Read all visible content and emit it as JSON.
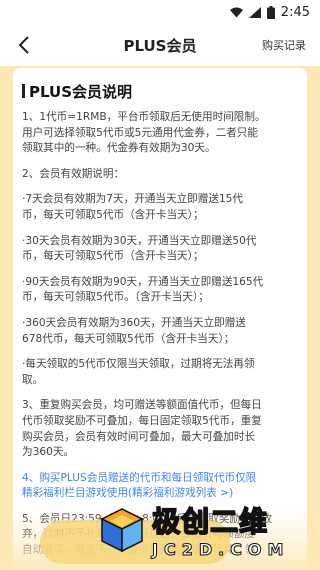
{
  "status_bar": {
    "time": "2:45"
  },
  "header": {
    "title": "PLUS会员",
    "records_link": "购买记录"
  },
  "card": {
    "title": "PLUS会员说明",
    "paragraphs": [
      {
        "lines": [
          "1、1代币=1RMB，平台币领取后无使用时间限制。",
          "用户可选择领取5代币或5元通用代金券，二者只能",
          "领取其中的一种。代金券有效期为30天。"
        ]
      },
      {
        "lines": [
          "2、会员有效期说明："
        ]
      },
      {
        "lines": [
          "·7天会员有效期为7天，开通当天立即赠送15代",
          "币，每天可领取5代币（含开卡当天）；"
        ]
      },
      {
        "lines": [
          "·30天会员有效期为30天，开通当天立即赠送50代",
          "币，每天可领取5代币（含开卡当天）；"
        ]
      },
      {
        "lines": [
          "·90天会员有效期为90天，开通当天立即赠送165代",
          "币，每天可领取5代币。（含开卡当天）；"
        ]
      },
      {
        "lines": [
          "·360天会员有效期为360天，开通当天立即赠送",
          "678代币，每天可领取5代币（含开卡当天）；"
        ]
      },
      {
        "lines": [
          "·每天领取的5代币仅限当天领取，过期将无法再领",
          "取。"
        ]
      },
      {
        "lines": [
          "3、重复购买会员，均可赠送等额面值代币，但每日",
          "代币领取奖励不可叠加，每日固定领取5代币，重复",
          "购买会员，会员有效时间可叠加，最大可叠加时长",
          "为360天。"
        ]
      },
      {
        "lines": [
          "4、购买PLUS会员赠送的代币和每日领取代币仅限",
          "精彩福利栏目游戏使用(精彩福利游戏列表 >)"
        ],
        "highlight": true
      },
      {
        "lines": [
          "5、会员日23:59（UTC+8:00）后未领取奖励视为放",
          "弃，过时不予补发。会员日过后，会员日可领额度",
          "自动清零，直至下一个会员日开启时重新计算。领"
        ]
      }
    ]
  },
  "watermark": {
    "title": "极创二维",
    "subtitle": "JC2D.COM"
  },
  "colors": {
    "page_bg": "#fce9b5",
    "link_blue": "#3f86f0",
    "button_yellow": "#f7d57a"
  }
}
